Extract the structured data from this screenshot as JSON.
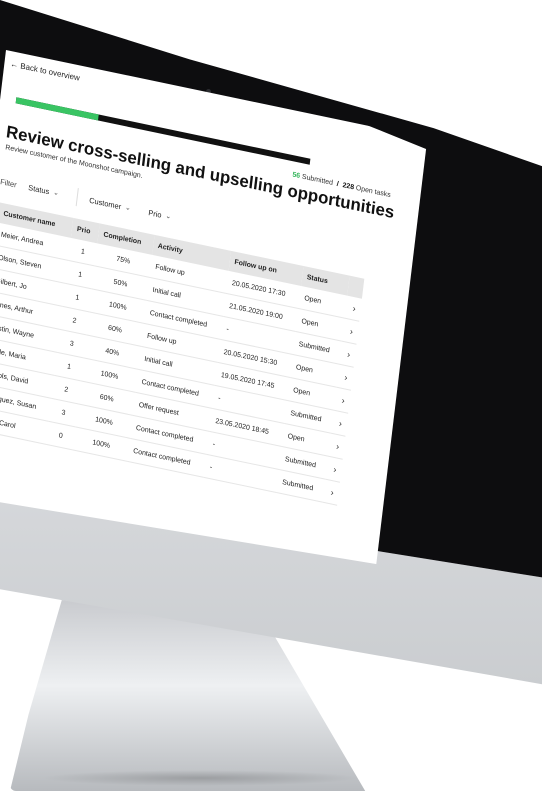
{
  "nav": {
    "back_label": "Back to overview"
  },
  "progress": {
    "fraction": 0.28
  },
  "header": {
    "title": "Review cross-selling and upselling opportunities",
    "subtitle": "Review customer of the Moonshot campaign.",
    "submitted_count": "56",
    "submitted_label": "Submitted",
    "separator": "/",
    "open_count": "228",
    "open_label": "Open tasks"
  },
  "filters": {
    "label": "Filter",
    "items": [
      {
        "label": "Status"
      },
      {
        "label": "Customer"
      },
      {
        "label": "Prio"
      }
    ]
  },
  "table": {
    "columns": [
      "Customer name",
      "Prio",
      "Completion",
      "Activity",
      "Follow up on",
      "Status"
    ],
    "rows": [
      {
        "name": "Meier, Andrea",
        "prio": "1",
        "completion": "75%",
        "activity": "Follow up",
        "follow_up": "20.05.2020 17:30",
        "status": "Open"
      },
      {
        "name": "Olson, Steven",
        "prio": "1",
        "completion": "50%",
        "activity": "Initial call",
        "follow_up": "21.05.2020 19:00",
        "status": "Open"
      },
      {
        "name": "Gilbert, Jo",
        "prio": "1",
        "completion": "100%",
        "activity": "Contact completed",
        "follow_up": "-",
        "status": "Submitted"
      },
      {
        "name": "Jones, Arthur",
        "prio": "2",
        "completion": "60%",
        "activity": "Follow up",
        "follow_up": "20.05.2020 15:30",
        "status": "Open"
      },
      {
        "name": "Austin, Wayne",
        "prio": "3",
        "completion": "40%",
        "activity": "Initial call",
        "follow_up": "19.05.2020 17:45",
        "status": "Open"
      },
      {
        "name": "Wade, Maria",
        "prio": "1",
        "completion": "100%",
        "activity": "Contact completed",
        "follow_up": "-",
        "status": "Submitted"
      },
      {
        "name": "Nichols, David",
        "prio": "2",
        "completion": "60%",
        "activity": "Offer request",
        "follow_up": "23.05.2020 18:45",
        "status": "Open"
      },
      {
        "name": "Rodriguez, Susan",
        "prio": "3",
        "completion": "100%",
        "activity": "Contact completed",
        "follow_up": "-",
        "status": "Submitted"
      },
      {
        "name": "Reed, Carol",
        "prio": "0",
        "completion": "100%",
        "activity": "Contact completed",
        "follow_up": "-",
        "status": "Submitted"
      }
    ]
  },
  "colors": {
    "accent_green": "#39c463",
    "bezel": "#0d0d0f",
    "header_bg": "#e4e4e4"
  },
  "icons": {
    "back": "arrow-left-icon",
    "dropdown": "chevron-down-icon",
    "row_open": "chevron-right-icon"
  }
}
